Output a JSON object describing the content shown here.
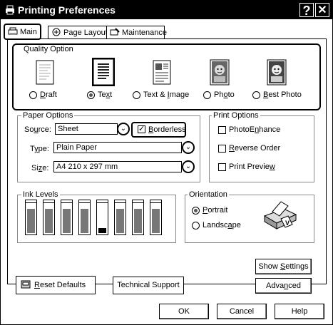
{
  "window": {
    "title": "Printing Preferences",
    "help_glyph": "?",
    "close_glyph": "✕"
  },
  "tabs": [
    {
      "label": "Main",
      "active": true
    },
    {
      "label": "Page Layout",
      "active": false
    },
    {
      "label": "Maintenance",
      "active": false
    }
  ],
  "quality": {
    "group_label": "Quality Option",
    "options": [
      {
        "label": "Draft",
        "selected": false,
        "icon": "draft-page-icon"
      },
      {
        "label": "Text",
        "selected": true,
        "icon": "text-page-icon"
      },
      {
        "label": "Text & Image",
        "selected": false,
        "icon": "text-image-page-icon"
      },
      {
        "label": "Photo",
        "selected": false,
        "icon": "photo-icon"
      },
      {
        "label": "Best Photo",
        "selected": false,
        "icon": "best-photo-icon"
      }
    ]
  },
  "paper": {
    "group_label": "Paper Options",
    "source_label": "Source:",
    "source_value": "Sheet",
    "borderless_label": "Borderless",
    "borderless_checked": true,
    "type_label": "Type:",
    "type_value": "Plain Paper",
    "size_label": "Size:",
    "size_value": "A4 210 x 297 mm"
  },
  "print_options": {
    "group_label": "Print Options",
    "items": [
      {
        "label": "PhotoEnhance",
        "checked": false
      },
      {
        "label": "Reverse Order",
        "checked": false
      },
      {
        "label": "Print Preview",
        "checked": false
      }
    ]
  },
  "ink": {
    "group_label": "Ink Levels",
    "levels": [
      0.85,
      0.85,
      0.85,
      0.85,
      0.18,
      0.85,
      0.85,
      0.85
    ]
  },
  "orientation": {
    "group_label": "Orientation",
    "options": [
      {
        "label": "Portrait",
        "selected": true
      },
      {
        "label": "Landscape",
        "selected": false
      }
    ]
  },
  "buttons": {
    "show_settings": "Show Settings",
    "advanced": "Advanced",
    "reset_defaults": "Reset Defaults",
    "technical_support": "Technical Support",
    "ok": "OK",
    "cancel": "Cancel",
    "help": "Help"
  }
}
